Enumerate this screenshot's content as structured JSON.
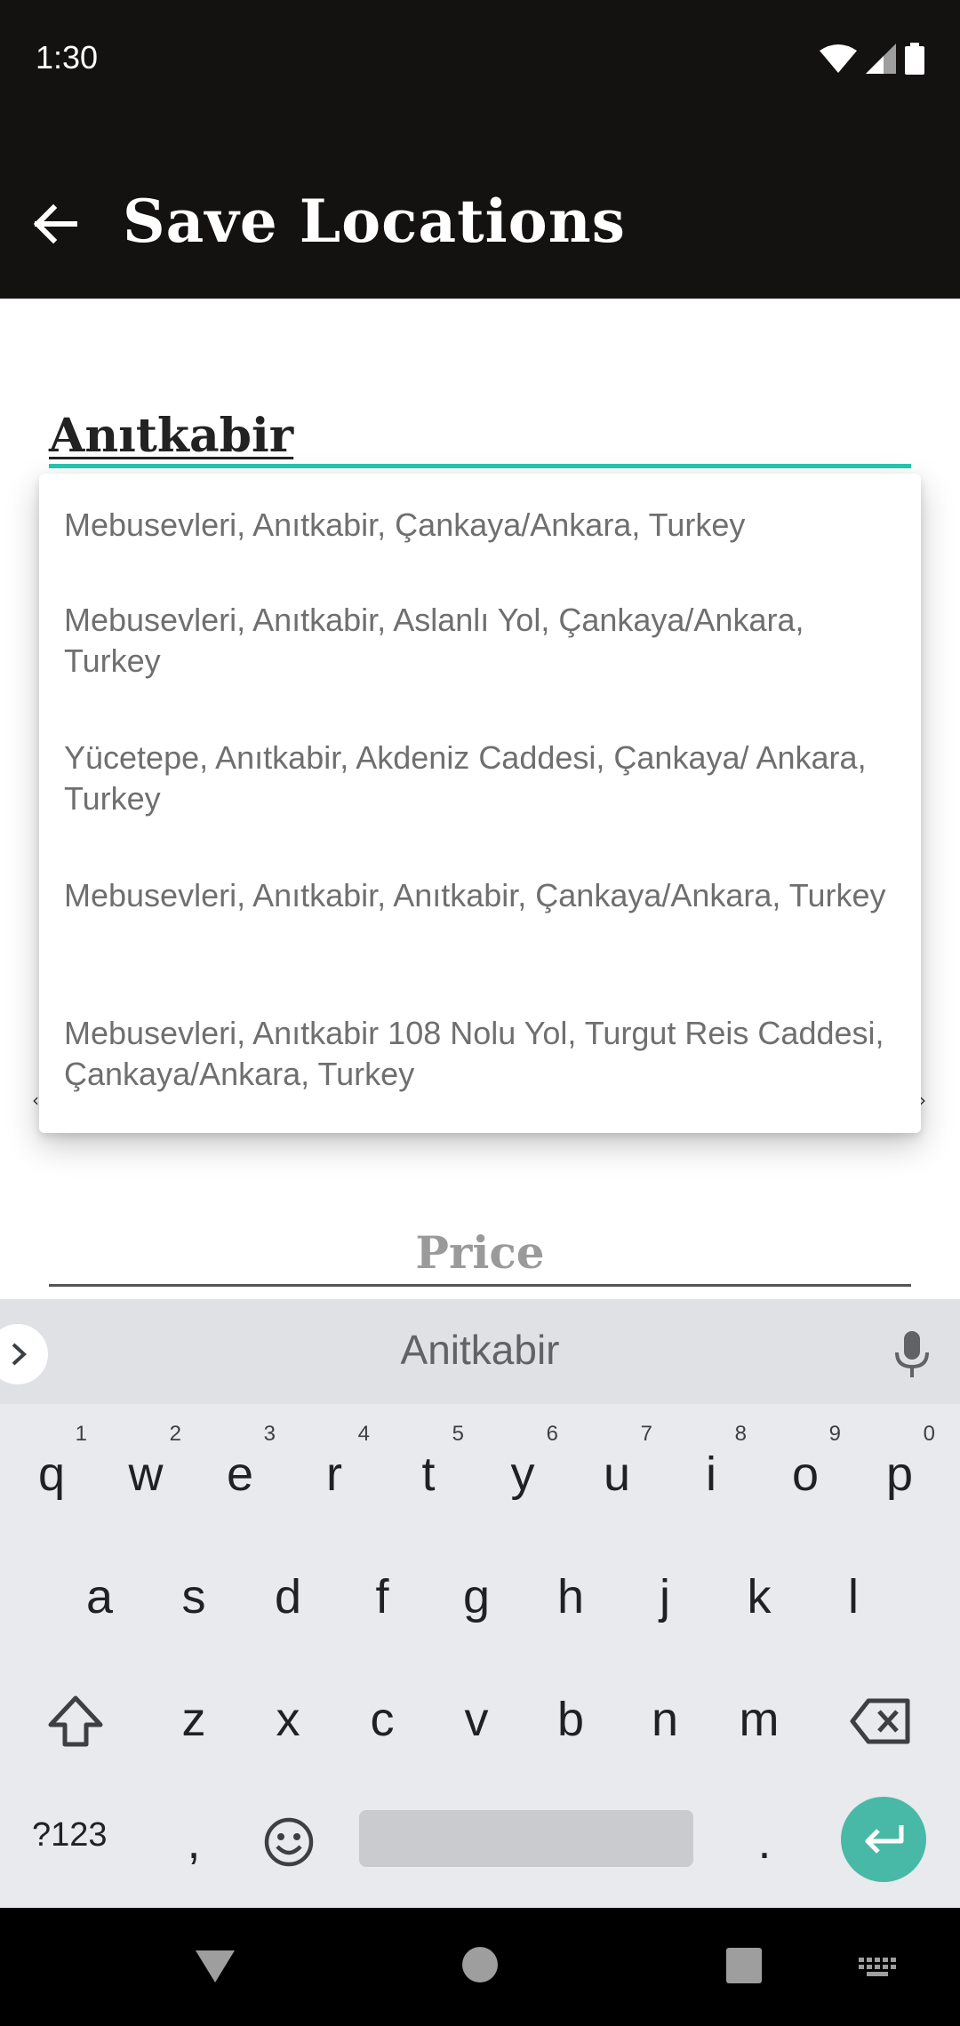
{
  "status_bar": {
    "time": "1:30"
  },
  "app_bar": {
    "title": "Save Locations"
  },
  "search": {
    "value": "Anıtkabir"
  },
  "suggestions": [
    "Mebusevleri, Anıtkabir, Çankaya/Ankara, Turkey",
    "Mebusevleri, Anıtkabir, Aslanlı Yol, Çankaya/Ankara, Turkey",
    "Yücetepe, Anıtkabir, Akdeniz Caddesi, Çankaya/ Ankara, Turkey",
    "Mebusevleri, Anıtkabir, Anıtkabir, Çankaya/Ankara, Turkey",
    "Mebusevleri, Anıtkabir 108 Nolu Yol, Turgut Reis Caddesi, Çankaya/Ankara, Turkey"
  ],
  "price": {
    "label": "Price"
  },
  "keyboard": {
    "suggestion": "Anitkabir",
    "row1": [
      {
        "k": "q",
        "h": "1"
      },
      {
        "k": "w",
        "h": "2"
      },
      {
        "k": "e",
        "h": "3"
      },
      {
        "k": "r",
        "h": "4"
      },
      {
        "k": "t",
        "h": "5"
      },
      {
        "k": "y",
        "h": "6"
      },
      {
        "k": "u",
        "h": "7"
      },
      {
        "k": "i",
        "h": "8"
      },
      {
        "k": "o",
        "h": "9"
      },
      {
        "k": "p",
        "h": "0"
      }
    ],
    "row2": [
      "a",
      "s",
      "d",
      "f",
      "g",
      "h",
      "j",
      "k",
      "l"
    ],
    "row3": [
      "z",
      "x",
      "c",
      "v",
      "b",
      "n",
      "m"
    ],
    "symbols_label": "?123",
    "comma": ",",
    "period": "."
  },
  "colors": {
    "accent": "#26c6b2",
    "enter": "#48b9a6",
    "topbar": "#141111"
  }
}
